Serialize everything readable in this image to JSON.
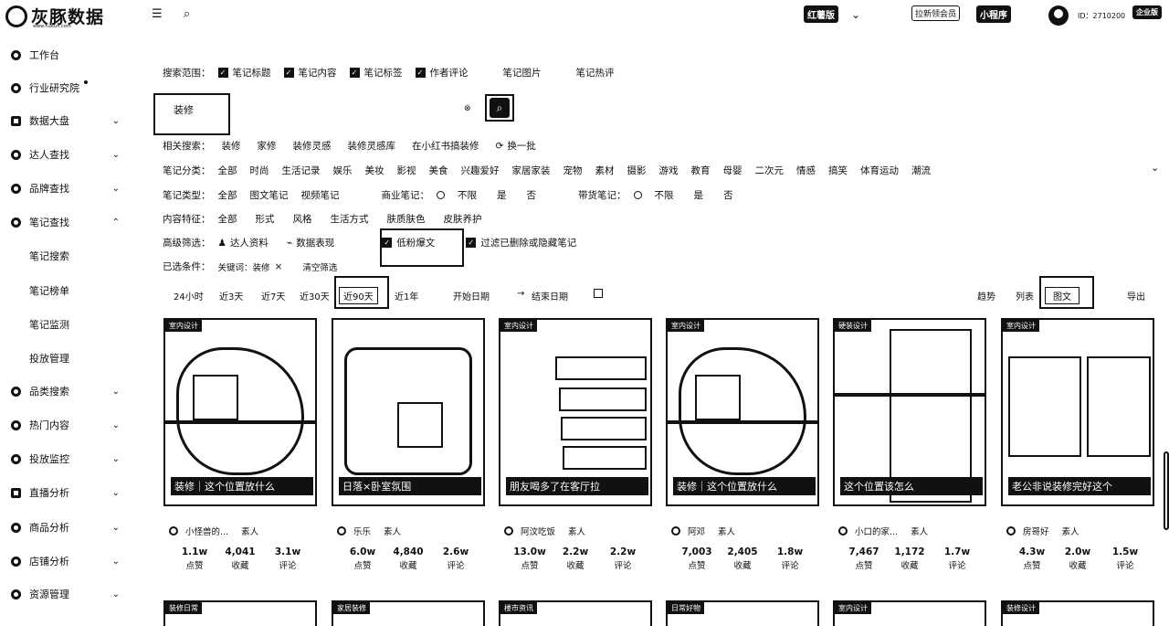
{
  "topbar": {
    "logo_text": "灰豚数据",
    "logo_sub": "www.huitun.com",
    "platform": "红薯版",
    "invite": "拉新领会员",
    "miniprogram": "小程序",
    "id_label": "ID：2710200",
    "vip": "企业版"
  },
  "sidebar": {
    "items": [
      {
        "label": "工作台",
        "chev": ""
      },
      {
        "label": "行业研究院",
        "chev": ""
      },
      {
        "label": "数据大盘",
        "chev": "⌄"
      },
      {
        "label": "达人查找",
        "chev": "⌄"
      },
      {
        "label": "品牌查找",
        "chev": "⌄"
      },
      {
        "label": "笔记查找",
        "chev": "⌃"
      },
      {
        "label": "品类搜索",
        "chev": "⌄"
      },
      {
        "label": "热门内容",
        "chev": "⌄"
      },
      {
        "label": "投放监控",
        "chev": "⌄"
      },
      {
        "label": "直播分析",
        "chev": "⌄"
      },
      {
        "label": "商品分析",
        "chev": "⌄"
      },
      {
        "label": "店铺分析",
        "chev": "⌄"
      },
      {
        "label": "资源管理",
        "chev": "⌄"
      }
    ],
    "subitems": [
      "笔记搜索",
      "笔记榜单",
      "笔记监测",
      "投放管理"
    ]
  },
  "filters": {
    "scope_label": "搜索范围：",
    "scope": [
      {
        "label": "笔记标题",
        "checked": true
      },
      {
        "label": "笔记内容",
        "checked": true
      },
      {
        "label": "笔记标签",
        "checked": true
      },
      {
        "label": "作者评论",
        "checked": true
      },
      {
        "label": "笔记图片",
        "checked": false
      },
      {
        "label": "笔记热评",
        "checked": false
      }
    ],
    "keyword": "装修",
    "related_label": "相关搜索：",
    "related": [
      "装修",
      "家修",
      "装修灵感",
      "装修灵感库",
      "在小红书搞装修"
    ],
    "refresh": "换一批",
    "category_label": "笔记分类：",
    "categories": [
      "全部",
      "时尚",
      "生活记录",
      "娱乐",
      "美妆",
      "影视",
      "美食",
      "兴趣爱好",
      "家居家装",
      "宠物",
      "素材",
      "摄影",
      "游戏",
      "教育",
      "母婴",
      "二次元",
      "情感",
      "搞笑",
      "体育运动",
      "潮流"
    ],
    "type_label": "笔记类型：",
    "types": [
      "全部",
      "图文笔记",
      "视频笔记"
    ],
    "commercial_label": "商业笔记：",
    "commercial": [
      "不限",
      "是",
      "否"
    ],
    "goods_label": "带货笔记：",
    "goods": [
      "不限",
      "是",
      "否"
    ],
    "feature_label": "内容特征：",
    "features": [
      "全部",
      "形式",
      "风格",
      "生活方式",
      "肤质肤色",
      "皮肤养护"
    ],
    "advanced_label": "高级筛选：",
    "adv_talent": "达人资料",
    "adv_data": "数据表现",
    "low_fans": "低粉爆文",
    "filter_deleted": "过滤已删除或隐藏笔记",
    "selected_label": "已选条件：",
    "selected_kw": "关键词：装修",
    "clear": "清空筛选",
    "time_tabs": [
      "24小时",
      "近3天",
      "近7天",
      "近30天",
      "近90天",
      "近1年"
    ],
    "start_date": "开始日期",
    "end_date": "结束日期",
    "view_trend": "趋势",
    "view_list": "列表",
    "view_grid": "图文",
    "export": "导出"
  },
  "cards": [
    {
      "tag": "室内设计",
      "caption": "装修｜这个位置放什么",
      "author": "小怪兽的...",
      "type": "素人",
      "likes": "1.1w",
      "collects": "4,041",
      "comments": "3.1w"
    },
    {
      "tag": "",
      "caption": "日落×卧室氛围",
      "author": "乐乐",
      "type": "素人",
      "likes": "6.0w",
      "collects": "4,840",
      "comments": "2.6w"
    },
    {
      "tag": "室内设计",
      "caption": "朋友喝多了在客厅拉",
      "author": "阿汶吃饭",
      "type": "素人",
      "likes": "13.0w",
      "collects": "2.2w",
      "comments": "2.2w"
    },
    {
      "tag": "室内设计",
      "caption": "装修｜这个位置放什么",
      "author": "阿邓",
      "type": "素人",
      "likes": "7,003",
      "collects": "2,405",
      "comments": "1.8w"
    },
    {
      "tag": "硬装设计",
      "caption": "这个位置该怎么",
      "author": "小口的家...",
      "type": "素人",
      "likes": "7,467",
      "collects": "1,172",
      "comments": "1.7w"
    },
    {
      "tag": "室内设计",
      "caption": "老公非说装修完好这个",
      "author": "房哥好",
      "type": "素人",
      "likes": "4.3w",
      "collects": "2.0w",
      "comments": "1.5w"
    }
  ],
  "stat_labels": {
    "likes": "点赞",
    "collects": "收藏",
    "comments": "评论"
  },
  "row2_tags": [
    "装修日常",
    "家居装修",
    "楼市资讯",
    "日常好物",
    "室内设计",
    "装修设计"
  ]
}
